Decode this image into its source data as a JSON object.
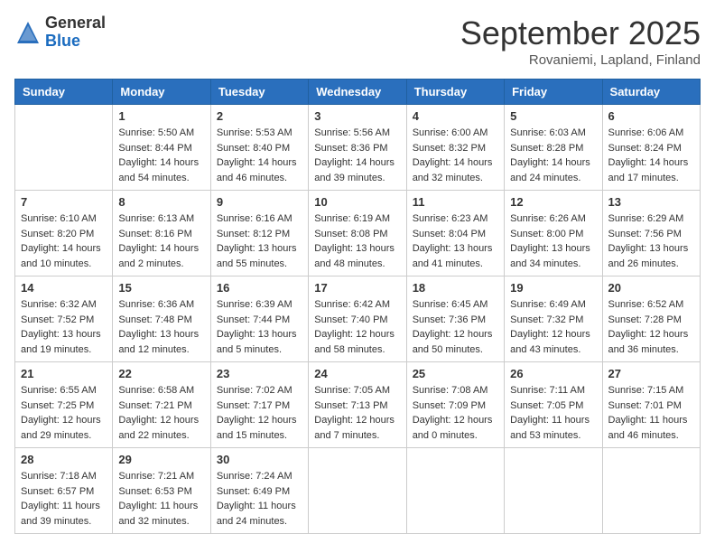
{
  "header": {
    "logo_general": "General",
    "logo_blue": "Blue",
    "month_title": "September 2025",
    "subtitle": "Rovaniemi, Lapland, Finland"
  },
  "weekdays": [
    "Sunday",
    "Monday",
    "Tuesday",
    "Wednesday",
    "Thursday",
    "Friday",
    "Saturday"
  ],
  "weeks": [
    [
      {
        "day": "",
        "info": ""
      },
      {
        "day": "1",
        "info": "Sunrise: 5:50 AM\nSunset: 8:44 PM\nDaylight: 14 hours\nand 54 minutes."
      },
      {
        "day": "2",
        "info": "Sunrise: 5:53 AM\nSunset: 8:40 PM\nDaylight: 14 hours\nand 46 minutes."
      },
      {
        "day": "3",
        "info": "Sunrise: 5:56 AM\nSunset: 8:36 PM\nDaylight: 14 hours\nand 39 minutes."
      },
      {
        "day": "4",
        "info": "Sunrise: 6:00 AM\nSunset: 8:32 PM\nDaylight: 14 hours\nand 32 minutes."
      },
      {
        "day": "5",
        "info": "Sunrise: 6:03 AM\nSunset: 8:28 PM\nDaylight: 14 hours\nand 24 minutes."
      },
      {
        "day": "6",
        "info": "Sunrise: 6:06 AM\nSunset: 8:24 PM\nDaylight: 14 hours\nand 17 minutes."
      }
    ],
    [
      {
        "day": "7",
        "info": "Sunrise: 6:10 AM\nSunset: 8:20 PM\nDaylight: 14 hours\nand 10 minutes."
      },
      {
        "day": "8",
        "info": "Sunrise: 6:13 AM\nSunset: 8:16 PM\nDaylight: 14 hours\nand 2 minutes."
      },
      {
        "day": "9",
        "info": "Sunrise: 6:16 AM\nSunset: 8:12 PM\nDaylight: 13 hours\nand 55 minutes."
      },
      {
        "day": "10",
        "info": "Sunrise: 6:19 AM\nSunset: 8:08 PM\nDaylight: 13 hours\nand 48 minutes."
      },
      {
        "day": "11",
        "info": "Sunrise: 6:23 AM\nSunset: 8:04 PM\nDaylight: 13 hours\nand 41 minutes."
      },
      {
        "day": "12",
        "info": "Sunrise: 6:26 AM\nSunset: 8:00 PM\nDaylight: 13 hours\nand 34 minutes."
      },
      {
        "day": "13",
        "info": "Sunrise: 6:29 AM\nSunset: 7:56 PM\nDaylight: 13 hours\nand 26 minutes."
      }
    ],
    [
      {
        "day": "14",
        "info": "Sunrise: 6:32 AM\nSunset: 7:52 PM\nDaylight: 13 hours\nand 19 minutes."
      },
      {
        "day": "15",
        "info": "Sunrise: 6:36 AM\nSunset: 7:48 PM\nDaylight: 13 hours\nand 12 minutes."
      },
      {
        "day": "16",
        "info": "Sunrise: 6:39 AM\nSunset: 7:44 PM\nDaylight: 13 hours\nand 5 minutes."
      },
      {
        "day": "17",
        "info": "Sunrise: 6:42 AM\nSunset: 7:40 PM\nDaylight: 12 hours\nand 58 minutes."
      },
      {
        "day": "18",
        "info": "Sunrise: 6:45 AM\nSunset: 7:36 PM\nDaylight: 12 hours\nand 50 minutes."
      },
      {
        "day": "19",
        "info": "Sunrise: 6:49 AM\nSunset: 7:32 PM\nDaylight: 12 hours\nand 43 minutes."
      },
      {
        "day": "20",
        "info": "Sunrise: 6:52 AM\nSunset: 7:28 PM\nDaylight: 12 hours\nand 36 minutes."
      }
    ],
    [
      {
        "day": "21",
        "info": "Sunrise: 6:55 AM\nSunset: 7:25 PM\nDaylight: 12 hours\nand 29 minutes."
      },
      {
        "day": "22",
        "info": "Sunrise: 6:58 AM\nSunset: 7:21 PM\nDaylight: 12 hours\nand 22 minutes."
      },
      {
        "day": "23",
        "info": "Sunrise: 7:02 AM\nSunset: 7:17 PM\nDaylight: 12 hours\nand 15 minutes."
      },
      {
        "day": "24",
        "info": "Sunrise: 7:05 AM\nSunset: 7:13 PM\nDaylight: 12 hours\nand 7 minutes."
      },
      {
        "day": "25",
        "info": "Sunrise: 7:08 AM\nSunset: 7:09 PM\nDaylight: 12 hours\nand 0 minutes."
      },
      {
        "day": "26",
        "info": "Sunrise: 7:11 AM\nSunset: 7:05 PM\nDaylight: 11 hours\nand 53 minutes."
      },
      {
        "day": "27",
        "info": "Sunrise: 7:15 AM\nSunset: 7:01 PM\nDaylight: 11 hours\nand 46 minutes."
      }
    ],
    [
      {
        "day": "28",
        "info": "Sunrise: 7:18 AM\nSunset: 6:57 PM\nDaylight: 11 hours\nand 39 minutes."
      },
      {
        "day": "29",
        "info": "Sunrise: 7:21 AM\nSunset: 6:53 PM\nDaylight: 11 hours\nand 32 minutes."
      },
      {
        "day": "30",
        "info": "Sunrise: 7:24 AM\nSunset: 6:49 PM\nDaylight: 11 hours\nand 24 minutes."
      },
      {
        "day": "",
        "info": ""
      },
      {
        "day": "",
        "info": ""
      },
      {
        "day": "",
        "info": ""
      },
      {
        "day": "",
        "info": ""
      }
    ]
  ]
}
